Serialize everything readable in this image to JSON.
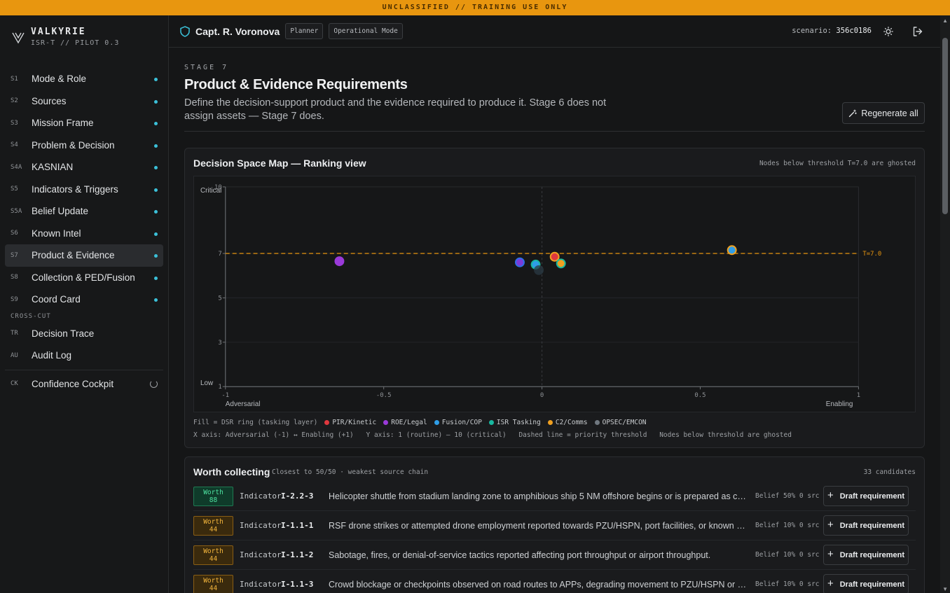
{
  "banner": "UNCLASSIFIED // TRAINING USE ONLY",
  "brand": {
    "name": "VALKYRIE",
    "sub": "ISR-T // PILOT 0.3"
  },
  "nav": [
    {
      "code": "S1",
      "label": "Mode & Role"
    },
    {
      "code": "S2",
      "label": "Sources"
    },
    {
      "code": "S3",
      "label": "Mission Frame"
    },
    {
      "code": "S4",
      "label": "Problem & Decision"
    },
    {
      "code": "S4A",
      "label": "KASNIAN"
    },
    {
      "code": "S5",
      "label": "Indicators & Triggers"
    },
    {
      "code": "S5A",
      "label": "Belief Update"
    },
    {
      "code": "S6",
      "label": "Known Intel"
    },
    {
      "code": "S7",
      "label": "Product & Evidence"
    },
    {
      "code": "S8",
      "label": "Collection & PED/Fusion"
    },
    {
      "code": "S9",
      "label": "Coord Card"
    }
  ],
  "nav_section": "CROSS-CUT",
  "crosscut": [
    {
      "code": "TR",
      "label": "Decision Trace"
    },
    {
      "code": "AU",
      "label": "Audit Log"
    }
  ],
  "cockpit": {
    "code": "CK",
    "label": "Confidence Cockpit"
  },
  "topbar": {
    "user": "Capt. R. Voronova",
    "role": "Planner",
    "mode": "Operational Mode",
    "scenario_label": "scenario:",
    "scenario_id": "356c0186"
  },
  "page": {
    "eyebrow": "STAGE 7",
    "title": "Product & Evidence Requirements",
    "description": "Define the decision-support product and the evidence required to produce it. Stage 6 does not assign assets — Stage 7 does.",
    "regenerate": "Regenerate all"
  },
  "map": {
    "title": "Decision Space Map — Ranking view",
    "note": "Nodes below threshold T=7.0 are ghosted",
    "legend_prefix": "Fill = DSR ring (tasking layer)",
    "legend": [
      {
        "label": "PIR/Kinetic",
        "color": "#e0383e"
      },
      {
        "label": "ROE/Legal",
        "color": "#9a3ad9"
      },
      {
        "label": "Fusion/COP",
        "color": "#2f9ee8"
      },
      {
        "label": "ISR Tasking",
        "color": "#18b8a0"
      },
      {
        "label": "C2/Comms",
        "color": "#f0a020"
      },
      {
        "label": "OPSEC/EMCON",
        "color": "#707880"
      }
    ],
    "notes": [
      "X axis: Adversarial (-1) ↔ Enabling (+1)",
      "Y axis: 1 (routine) — 10 (critical)",
      "Dashed line = priority threshold",
      "Nodes below threshold are ghosted"
    ]
  },
  "chart_data": {
    "type": "scatter",
    "title": "Decision Space Map — Ranking view",
    "xlim": [
      -1,
      1
    ],
    "ylim": [
      1,
      10
    ],
    "x_ticks": [
      "-1",
      "-0.5",
      "0",
      "0.5",
      "1"
    ],
    "x_tick_values": [
      -1,
      -0.5,
      0,
      0.5,
      1
    ],
    "y_ticks": [
      "1",
      "3",
      "5",
      "7",
      "10"
    ],
    "y_tick_values": [
      1,
      3,
      5,
      7,
      10
    ],
    "x_end_labels": [
      "Adversarial",
      "Enabling"
    ],
    "y_end_labels": [
      "Low",
      "Critical"
    ],
    "threshold": {
      "value": 7,
      "label": "T=7.0"
    },
    "grid": true,
    "points": [
      {
        "x": -0.64,
        "y": 6.65,
        "color": "#9a3ad9",
        "ring": "#9a3ad9"
      },
      {
        "x": -0.07,
        "y": 6.6,
        "color": "#7a3ad9",
        "ring": "#2f6ee8"
      },
      {
        "x": -0.02,
        "y": 6.5,
        "color": "#2f9ee8",
        "ring": "#18b8a0"
      },
      {
        "x": -0.01,
        "y": 6.25,
        "color": "#2a3a44",
        "ring": "#2a3a44"
      },
      {
        "x": 0.04,
        "y": 6.85,
        "color": "#e0383e",
        "ring": "#f0a020"
      },
      {
        "x": 0.06,
        "y": 6.55,
        "color": "#f0a020",
        "ring": "#18b8a0"
      },
      {
        "x": 0.6,
        "y": 7.15,
        "color": "#2f9ee8",
        "ring": "#f0a020"
      }
    ]
  },
  "worth": {
    "title": "Worth collecting",
    "sub": "Closest to 50/50 · weakest source chain",
    "count": "33 candidates",
    "draft_label": "Draft requirement",
    "rows": [
      {
        "worth": "Worth 88",
        "level": "hi",
        "type": "Indicator",
        "id": "I-2.2-3",
        "text": "Helicopter shuttle from stadium landing zone to amphibious ship 5 NM offshore begins or is prepared as continuous lift.",
        "belief": "Belief 50% 0 src"
      },
      {
        "worth": "Worth 44",
        "level": "mid",
        "type": "Indicator",
        "id": "I-1.1-1",
        "text": "RSF drone strikes or attempted drone employment reported towards PZU/HSPN, port facilities, or known RSF staging areas.",
        "belief": "Belief 10% 0 src"
      },
      {
        "worth": "Worth 44",
        "level": "mid",
        "type": "Indicator",
        "id": "I-1.1-2",
        "text": "Sabotage, fires, or denial-of-service tactics reported affecting port throughput or airport throughput.",
        "belief": "Belief 10% 0 src"
      },
      {
        "worth": "Worth 44",
        "level": "mid",
        "type": "Indicator",
        "id": "I-1.1-3",
        "text": "Crowd blockage or checkpoints observed on road routes to APPs, degrading movement to PZU/HSPN or port.",
        "belief": "Belief 10% 0 src"
      }
    ]
  }
}
